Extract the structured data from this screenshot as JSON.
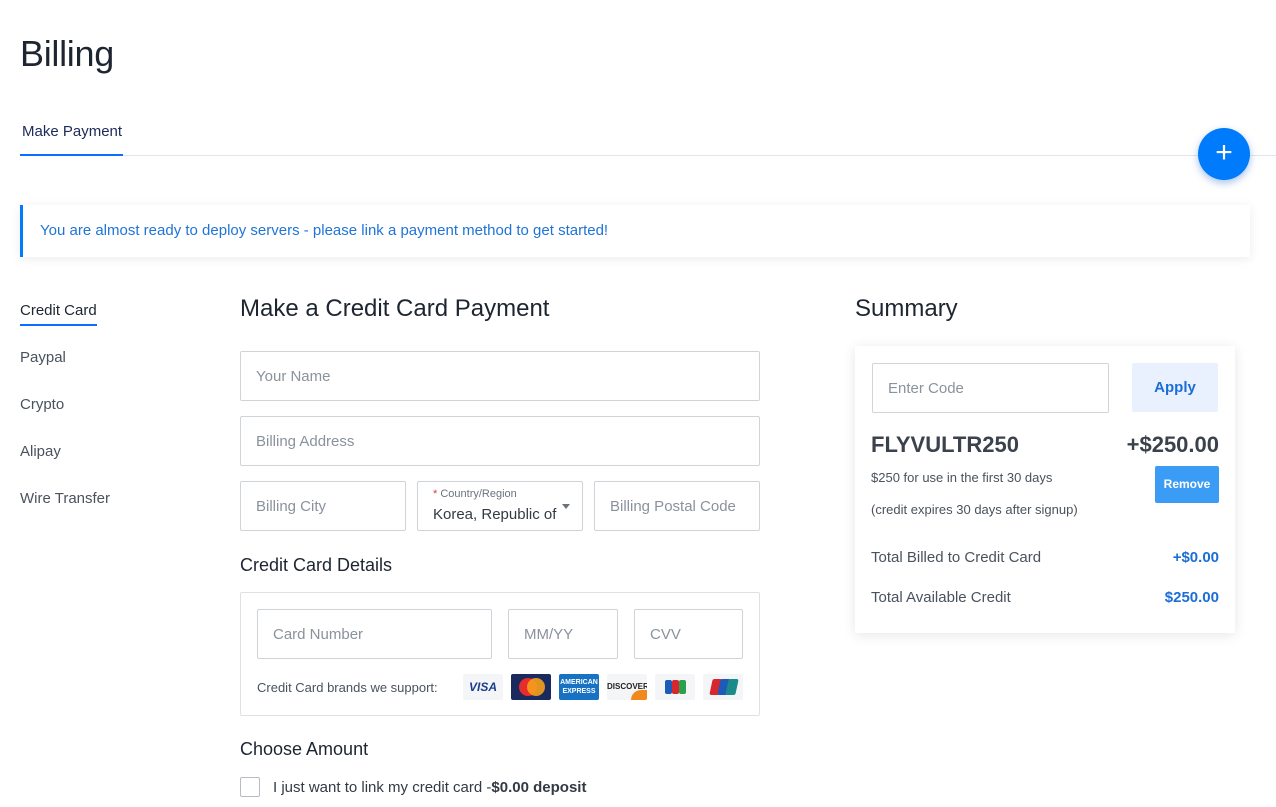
{
  "page": {
    "title": "Billing"
  },
  "tabs": [
    {
      "label": "Make Payment",
      "active": true
    }
  ],
  "fab": {
    "icon": "plus-icon",
    "label": "+"
  },
  "alert": {
    "text": "You are almost ready to deploy servers - please link a payment method to get started!"
  },
  "side_nav": {
    "items": [
      {
        "label": "Credit Card",
        "active": true
      },
      {
        "label": "Paypal",
        "active": false
      },
      {
        "label": "Crypto",
        "active": false
      },
      {
        "label": "Alipay",
        "active": false
      },
      {
        "label": "Wire Transfer",
        "active": false
      }
    ]
  },
  "form": {
    "title": "Make a Credit Card Payment",
    "name_placeholder": "Your Name",
    "address_placeholder": "Billing Address",
    "city_placeholder": "Billing City",
    "country": {
      "required_mark": "*",
      "label": "Country/Region",
      "value": "Korea, Republic of"
    },
    "postal_placeholder": "Billing Postal Code",
    "card_details_title": "Credit Card Details",
    "card_number_placeholder": "Card Number",
    "expiry_placeholder": "MM/YY",
    "cvv_placeholder": "CVV",
    "brands_label": "Credit Card brands we support:",
    "brands": [
      {
        "name": "visa",
        "text": "VISA"
      },
      {
        "name": "mastercard",
        "text": ""
      },
      {
        "name": "american-express",
        "text": "AMERICAN EXPRESS"
      },
      {
        "name": "discover",
        "text": "DISCOVER"
      },
      {
        "name": "jcb",
        "text": ""
      },
      {
        "name": "unionpay",
        "text": ""
      }
    ],
    "choose_amount_title": "Choose Amount",
    "link_card_label": "I just want to link my credit card -",
    "link_card_amount": "$0.00 deposit",
    "link_card_checked": false
  },
  "summary": {
    "title": "Summary",
    "code_placeholder": "Enter Code",
    "apply_label": "Apply",
    "promo_code": "FLYVULTR250",
    "promo_amount": "+$250.00",
    "promo_desc_1": "$250 for use in the first 30 days",
    "promo_desc_2": "(credit expires 30 days after signup)",
    "remove_label": "Remove",
    "billed_label": "Total Billed to Credit Card",
    "billed_value": "+$0.00",
    "credit_label": "Total Available Credit",
    "credit_value": "$250.00"
  },
  "colors": {
    "accent": "#007bfc",
    "link_blue": "#1b6ed6",
    "remove_blue": "#3b9cf5"
  }
}
